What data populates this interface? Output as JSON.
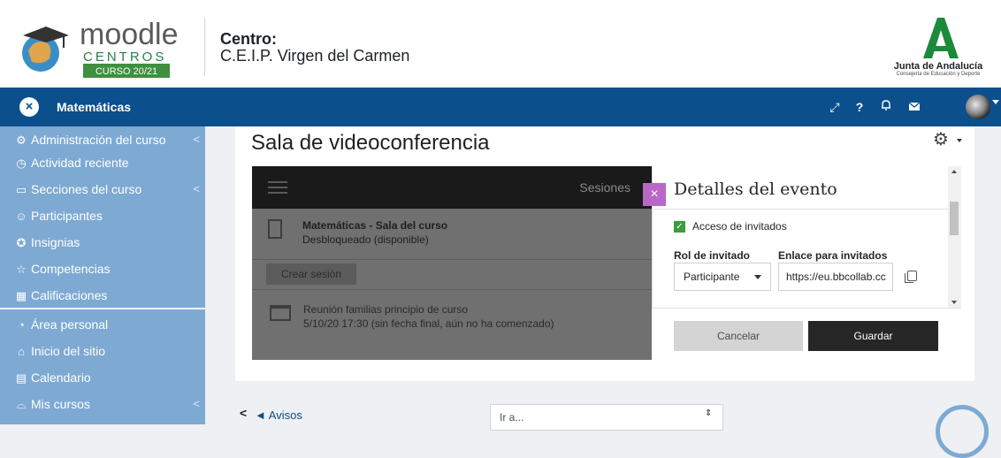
{
  "header": {
    "logo": {
      "word": "moodle",
      "sub": "CENTROS",
      "badge": "CURSO 20/21"
    },
    "centro_label": "Centro:",
    "centro_name": "C.E.I.P. Virgen del Carmen",
    "junta_name": "Junta de Andalucía",
    "junta_sub": "Consejería de Educación y Deporte"
  },
  "navbar": {
    "course": "Matemáticas",
    "close_glyph": "×",
    "icons": [
      "expand-icon",
      "help-icon",
      "bell-icon",
      "mail-icon"
    ],
    "color": "#0b4f8c"
  },
  "sidebar": {
    "items": [
      {
        "label": "Administración del curso",
        "icon": "gear-icon"
      },
      {
        "label": "Actividad reciente",
        "icon": "clock-icon"
      },
      {
        "label": "Secciones del curso",
        "icon": "folder-icon"
      },
      {
        "label": "Participantes",
        "icon": "people-icon"
      },
      {
        "label": "Insignias",
        "icon": "badge-icon"
      },
      {
        "label": "Competencias",
        "icon": "star-icon"
      },
      {
        "label": "Calificaciones",
        "icon": "grades-icon"
      },
      {
        "label": "Área personal",
        "icon": "dashboard-icon"
      },
      {
        "label": "Inicio del sitio",
        "icon": "home-icon"
      },
      {
        "label": "Calendario",
        "icon": "calendar-icon"
      },
      {
        "label": "Mis cursos",
        "icon": "mortarboard-icon"
      }
    ],
    "chevron": "<",
    "color": "#7ea9d2"
  },
  "main": {
    "title": "Sala de videoconferencia",
    "collab": {
      "sessions_label": "Sesiones",
      "room_name": "Matemáticas - Sala del curso",
      "room_status": "Desbloqueado (disponible)",
      "create_button": "Crear sesión",
      "session_name": "Reunión familias principio de curso",
      "session_date": "5/10/20 17:30 (sin fecha final, aún no ha comenzado)"
    },
    "panel": {
      "title": "Detalles del evento",
      "close_glyph": "×",
      "guest_access_label": "Acceso de invitados",
      "guest_access_checked": true,
      "role_label": "Rol de invitado",
      "role_value": "Participante",
      "link_label": "Enlace para invitados",
      "link_value": "https://eu.bbcollab.cc",
      "cancel_button": "Cancelar",
      "save_button": "Guardar",
      "accent": "#b968c7"
    }
  },
  "footer_nav": {
    "prev_link": "◄ Avisos",
    "jump_placeholder": "Ir a..."
  }
}
